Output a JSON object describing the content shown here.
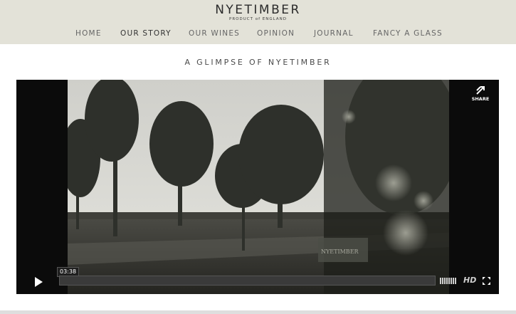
{
  "header": {
    "brand": "NYETIMBER",
    "tagline": "PRODUCT of ENGLAND"
  },
  "nav": {
    "items": [
      "HOME",
      "OUR STORY",
      "OUR WINES",
      "OPINION",
      "JOURNAL",
      "FANCY A GLASS"
    ],
    "active": "OUR STORY"
  },
  "main": {
    "title": "A GLIMPSE OF NYETIMBER"
  },
  "video": {
    "share_label": "SHARE",
    "time": "03:38",
    "progress": 0.0,
    "hd_label": "HD",
    "sign_text": "NYETIMBER",
    "icons": [
      "share-icon",
      "play-icon",
      "volume-icon",
      "fullscreen-icon"
    ]
  },
  "colors": {
    "header_bg": "#e3e2d8",
    "player_bg": "#0b0b0b"
  }
}
